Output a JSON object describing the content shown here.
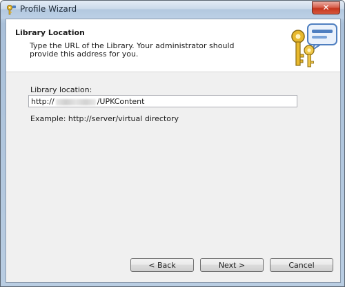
{
  "window": {
    "title": "Profile Wizard",
    "close_label": "✕"
  },
  "header": {
    "title": "Library Location",
    "description": "Type the URL of the Library. Your administrator should provide this address for you.",
    "art_icon": "keys-speech-bubble-icon"
  },
  "form": {
    "label": "Library location:",
    "url_prefix": "http://",
    "url_suffix": "/UPKContent",
    "example": "Example: http://server/virtual directory"
  },
  "buttons": {
    "back": "< Back",
    "next": "Next >",
    "cancel": "Cancel"
  },
  "colors": {
    "accent_gold": "#e8b92e",
    "bubble_blue": "#4f7fc0",
    "close_red": "#c5361f"
  }
}
